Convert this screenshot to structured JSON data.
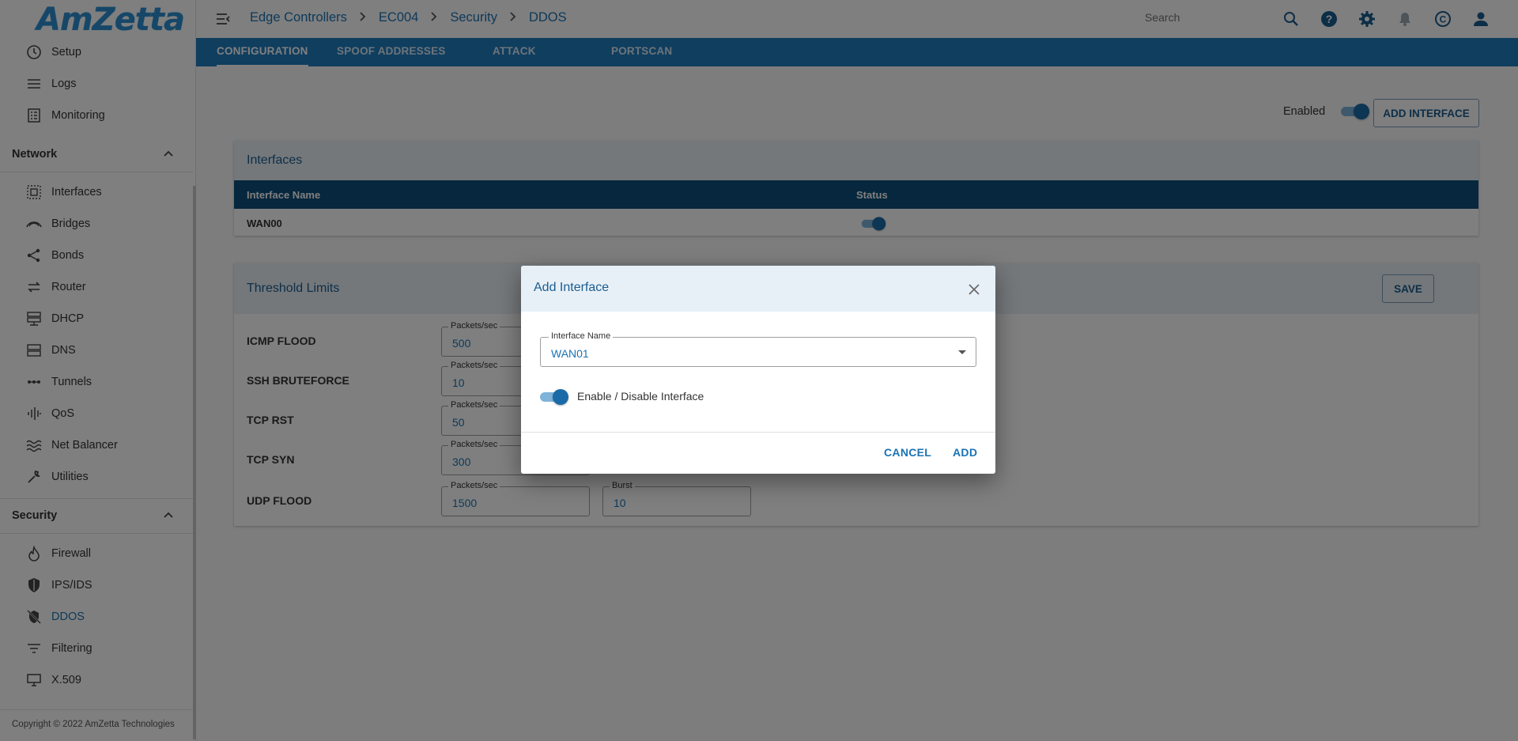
{
  "app": {
    "logo_text": "AmZetta",
    "copyright": "Copyright © 2022 AmZetta Technologies"
  },
  "sidebar": {
    "top_items": [
      {
        "label": "Setup",
        "icon": "clock-icon"
      },
      {
        "label": "Logs",
        "icon": "list-icon"
      },
      {
        "label": "Monitoring",
        "icon": "chart-icon"
      }
    ],
    "network": {
      "title": "Network",
      "items": [
        {
          "label": "Interfaces",
          "icon": "interfaces-icon"
        },
        {
          "label": "Bridges",
          "icon": "bridge-icon"
        },
        {
          "label": "Bonds",
          "icon": "share-icon"
        },
        {
          "label": "Router",
          "icon": "swap-icon"
        },
        {
          "label": "DHCP",
          "icon": "dhcp-icon"
        },
        {
          "label": "DNS",
          "icon": "dns-icon"
        },
        {
          "label": "Tunnels",
          "icon": "tunnel-icon"
        },
        {
          "label": "QoS",
          "icon": "qos-icon"
        },
        {
          "label": "Net Balancer",
          "icon": "waves-icon"
        },
        {
          "label": "Utilities",
          "icon": "wrench-icon"
        }
      ]
    },
    "security": {
      "title": "Security",
      "items": [
        {
          "label": "Firewall",
          "icon": "flame-icon"
        },
        {
          "label": "IPS/IDS",
          "icon": "shield-icon"
        },
        {
          "label": "DDOS",
          "icon": "ddos-shield-icon",
          "active": true
        },
        {
          "label": "Filtering",
          "icon": "filter-icon"
        },
        {
          "label": "X.509",
          "icon": "monitor-icon"
        }
      ]
    }
  },
  "header": {
    "breadcrumb": [
      "Edge Controllers",
      "EC004",
      "Security",
      "DDOS"
    ],
    "search_placeholder": "Search"
  },
  "tabs": [
    "CONFIGURATION",
    "SPOOF ADDRESSES",
    "ATTACK",
    "PORTSCAN"
  ],
  "main": {
    "enabled_label": "Enabled",
    "enabled": true,
    "add_interface_label": "ADD INTERFACE",
    "interfaces": {
      "title": "Interfaces",
      "columns": [
        "Interface Name",
        "Status"
      ],
      "rows": [
        {
          "name": "WAN00",
          "status": true
        }
      ]
    },
    "thresholds": {
      "title": "Threshold Limits",
      "save_label": "SAVE",
      "rows": [
        {
          "label": "ICMP FLOOD",
          "pps_label": "Packets/sec",
          "pps": "500"
        },
        {
          "label": "SSH BRUTEFORCE",
          "pps_label": "Packets/sec",
          "pps": "10"
        },
        {
          "label": "TCP RST",
          "pps_label": "Packets/sec",
          "pps": "50"
        },
        {
          "label": "TCP SYN",
          "pps_label": "Packets/sec",
          "pps": "300"
        },
        {
          "label": "UDP FLOOD",
          "pps_label": "Packets/sec",
          "pps": "1500",
          "burst_label": "Burst",
          "burst": "10"
        }
      ]
    }
  },
  "dialog": {
    "title": "Add Interface",
    "field_label": "Interface Name",
    "field_value": "WAN01",
    "toggle_label": "Enable / Disable Interface",
    "toggle_on": true,
    "cancel_label": "CANCEL",
    "add_label": "ADD"
  },
  "colors": {
    "accent": "#1f7cbf",
    "table_header": "#0d4e7a",
    "card_header": "#e8f0f7"
  }
}
